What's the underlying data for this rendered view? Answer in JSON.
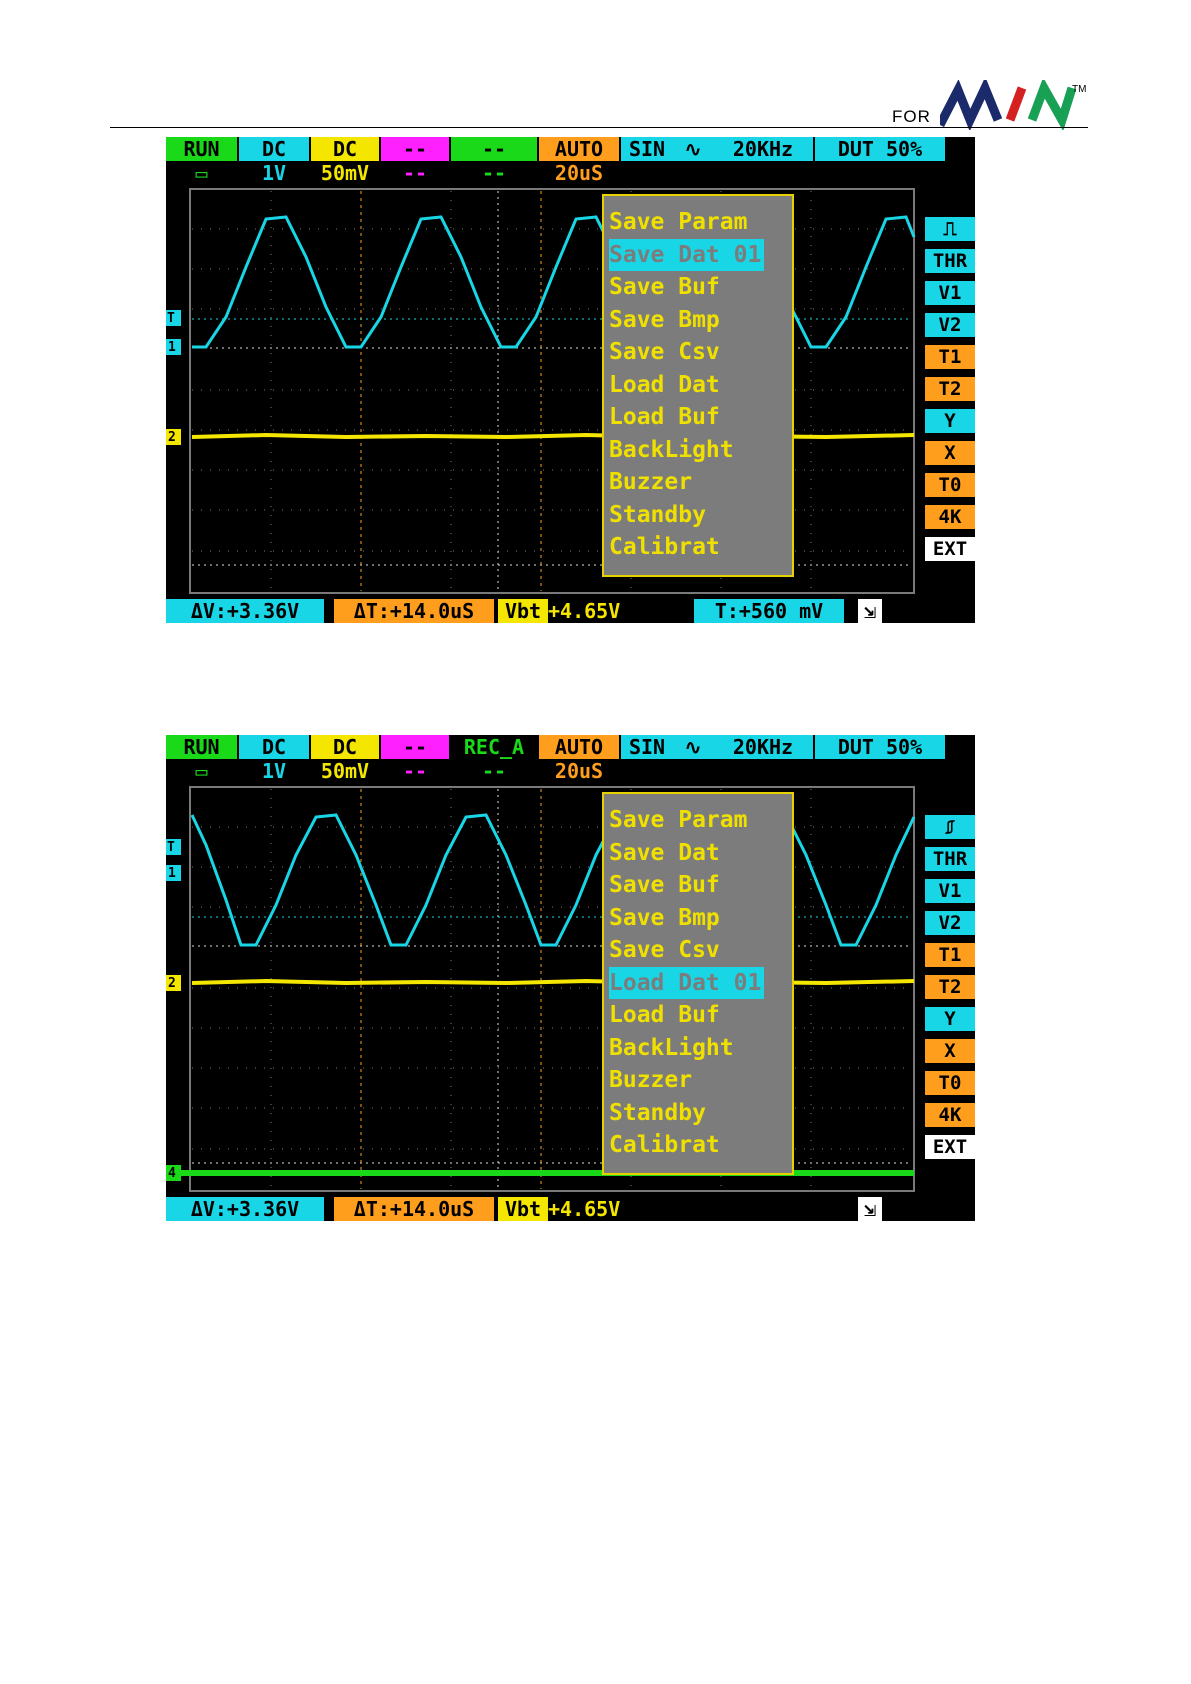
{
  "header": {
    "for_text": "FOR",
    "logo": "MINI logo",
    "tm": "TM"
  },
  "screens": [
    {
      "top_row": [
        "RUN",
        "DC",
        "DC",
        "--",
        "--",
        "AUTO",
        "SIN",
        "20KHz",
        "DUT 50%"
      ],
      "second_row": [
        "1V",
        "50mV",
        "--",
        "--",
        "20uS"
      ],
      "side_labels": [
        "THR",
        "V1",
        "V2",
        "T1",
        "T2",
        "Y",
        "X",
        "T0",
        "4K",
        "EXT"
      ],
      "menu": [
        "Save Param",
        "Save Dat 01",
        "Save Buf",
        "Save Bmp",
        "Save Csv",
        "Load Dat",
        "Load Buf",
        "BackLight",
        "Buzzer",
        "Standby",
        "Calibrat"
      ],
      "selected": 1,
      "status": [
        "ΔV:+3.36V",
        "ΔT:+14.0uS",
        "Vbt",
        "+4.65V",
        "T:+560 mV"
      ],
      "markers": [
        "T",
        "1",
        "2"
      ]
    },
    {
      "top_row": [
        "RUN",
        "DC",
        "DC",
        "--",
        "REC_A",
        "AUTO",
        "SIN",
        "20KHz",
        "DUT 50%"
      ],
      "second_row": [
        "1V",
        "50mV",
        "--",
        "--",
        "20uS"
      ],
      "side_labels": [
        "THR",
        "V1",
        "V2",
        "T1",
        "T2",
        "Y",
        "X",
        "T0",
        "4K",
        "EXT"
      ],
      "menu": [
        "Save Param",
        "Save Dat",
        "Save Buf",
        "Save Bmp",
        "Save Csv",
        "Load Dat 01",
        "Load Buf",
        "BackLight",
        "Buzzer",
        "Standby",
        "Calibrat"
      ],
      "selected": 5,
      "status": [
        "ΔV:+3.36V",
        "ΔT:+14.0uS",
        "Vbt",
        "+4.65V",
        ""
      ],
      "markers": [
        "T",
        "1",
        "2",
        "4"
      ]
    }
  ],
  "colors": {
    "cyan": "#19d6e6",
    "yellow": "#f5e600",
    "green": "#19d919",
    "magenta": "#ff20ff",
    "orange": "#ff9d1d",
    "white": "#ffffff",
    "gray": "#7c7c7c"
  }
}
